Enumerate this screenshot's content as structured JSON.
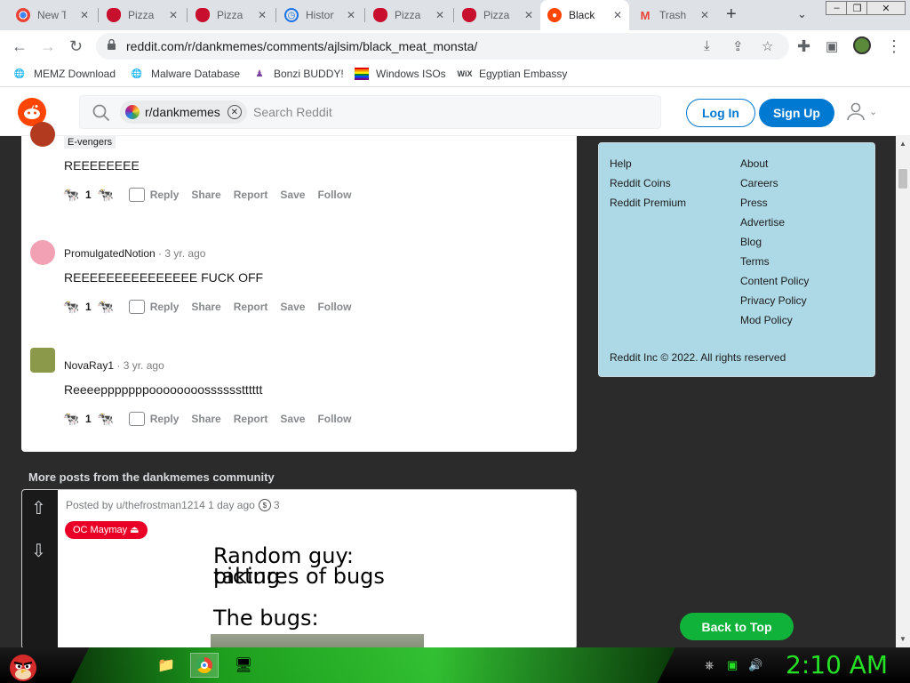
{
  "browser": {
    "tabs": [
      {
        "label": "New Tab",
        "icon": "chrome-icon",
        "color": "#5f6368"
      },
      {
        "label": "Pizza Hut",
        "icon": "pizza-hut-icon",
        "color": "#c8102e"
      },
      {
        "label": "Pizza Hut",
        "icon": "pizza-hut-icon",
        "color": "#c8102e"
      },
      {
        "label": "History",
        "icon": "history-icon",
        "color": "#1a73e8"
      },
      {
        "label": "Pizza Hut",
        "icon": "pizza-hut-icon",
        "color": "#c8102e"
      },
      {
        "label": "Pizza Hut",
        "icon": "pizza-hut-icon",
        "color": "#c8102e"
      },
      {
        "label": "Black meat monsta",
        "icon": "reddit-icon",
        "color": "#ff4500",
        "active": true
      },
      {
        "label": "Trash",
        "icon": "gmail-icon",
        "color": "#ea4335"
      }
    ],
    "url": "reddit.com/r/dankmemes/comments/ajlsim/black_meat_monsta/",
    "bookmarks": [
      {
        "label": "MEMZ Download",
        "icon": "globe-icon"
      },
      {
        "label": "Malware Database",
        "icon": "globe-icon"
      },
      {
        "label": "Bonzi BUDDY!",
        "icon": "bonzi-icon"
      },
      {
        "label": "Windows ISOs",
        "icon": "rainbow-flag-icon"
      },
      {
        "label": "Egyptian Embassy",
        "icon": "wix-icon"
      }
    ]
  },
  "reddit": {
    "search_chip": "r/dankmemes",
    "search_placeholder": "Search Reddit",
    "login_label": "Log In",
    "signup_label": "Sign Up",
    "accent": "#0079d3"
  },
  "comments": [
    {
      "flair": "E-vengers",
      "body": "REEEEEEEE",
      "score": "1"
    },
    {
      "author": "PromulgatedNotion",
      "age": "· 3 yr. ago",
      "body": "REEEEEEEEEEEEEEE FUCK OFF",
      "score": "1"
    },
    {
      "author": "NovaRay1",
      "age": "· 3 yr. ago",
      "body": "Reeeepppppppoooooooosssssstttttt",
      "score": "1"
    }
  ],
  "comment_actions": {
    "reply": "Reply",
    "share": "Share",
    "report": "Report",
    "save": "Save",
    "follow": "Follow"
  },
  "sidebar": {
    "left_links": [
      "Help",
      "Reddit Coins",
      "Reddit Premium"
    ],
    "right_links": [
      "About",
      "Careers",
      "Press",
      "Advertise",
      "Blog",
      "Terms",
      "Content Policy",
      "Privacy Policy",
      "Mod Policy"
    ],
    "copyright": "Reddit Inc © 2022. All rights reserved",
    "bg_color": "#add8e6"
  },
  "more_posts": {
    "title": "More posts from the dankmemes community",
    "post": {
      "meta": "Posted by u/thefrostman1214 1 day ago",
      "awards": "3",
      "flair": "OC Maymay ⏏",
      "meme_lines": [
        "Random guy: taking",
        "pictures of bugs",
        "The bugs:"
      ]
    }
  },
  "back_to_top": "Back to Top",
  "taskbar": {
    "clock": "2:10 AM"
  }
}
